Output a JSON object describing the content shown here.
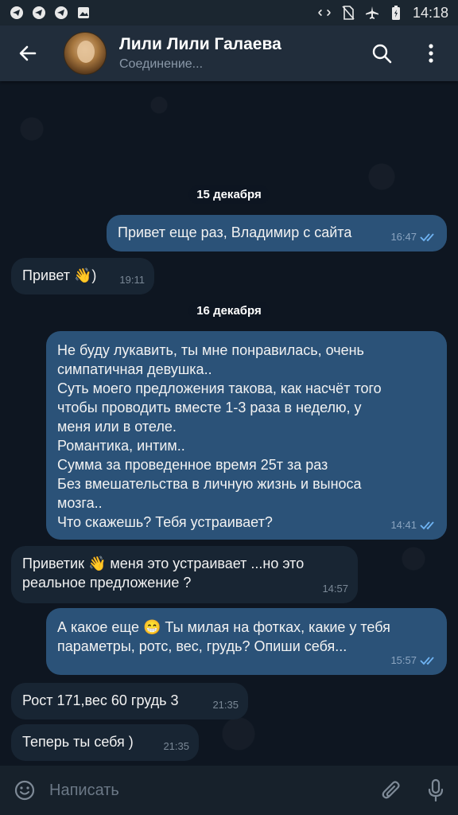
{
  "statusbar": {
    "time": "14:18",
    "left_icons": [
      "telegram-icon",
      "telegram-icon",
      "telegram-icon",
      "image-icon"
    ],
    "right_icons": [
      "data-arrows-icon",
      "no-sim-icon",
      "airplane-icon",
      "battery-icon"
    ]
  },
  "header": {
    "title": "Лили Лили Галаева",
    "status": "Соединение...",
    "icons": {
      "back": "arrow-left-icon",
      "search": "search-icon",
      "menu": "more-vertical-icon"
    }
  },
  "dates": {
    "first": "15 декабря",
    "second": "16 декабря"
  },
  "messages": [
    {
      "direction": "out",
      "text": "Привет еще раз, Владимир с сайта",
      "time": "16:47",
      "read": true
    },
    {
      "direction": "in",
      "text": "Привет 👋)",
      "time": "19:11"
    },
    {
      "direction": "out",
      "text": "Не буду лукавить, ты мне понравилась, очень\nсимпатичная девушка..\nСуть моего предложения такова, как насчёт того\nчтобы проводить вместе 1-3 раза в неделю, у\nменя или в отеле.\nРомантика, интим..\nСумма за проведенное время 25т за раз\nБез вмешательства в личную жизнь и выноса\nмозга..\nЧто скажешь? Тебя устраивает?",
      "time": "14:41",
      "read": true
    },
    {
      "direction": "in",
      "text": "Приветик 👋 меня это устраивает ...но это\nреальное предложение ?",
      "time": "14:57"
    },
    {
      "direction": "out",
      "text": "А какое еще 😁 Ты милая на фотках, какие у тебя\nпараметры, ротс, вес, грудь? Опиши себя...",
      "time": "15:57",
      "read": true
    },
    {
      "direction": "in",
      "text": "Рост 171,вес 60 грудь 3",
      "time": "21:35"
    },
    {
      "direction": "in",
      "text": "Теперь ты себя )",
      "time": "21:35"
    }
  ],
  "composer": {
    "placeholder": "Написать",
    "icons": {
      "emoji": "smile-icon",
      "attach": "paperclip-icon",
      "voice": "microphone-icon"
    }
  },
  "colors": {
    "header_bg": "#212d3b",
    "chat_bg": "#0e1621",
    "outgoing_bubble": "#2b5278",
    "incoming_bubble": "#182533",
    "read_check": "#6fb3f2"
  }
}
